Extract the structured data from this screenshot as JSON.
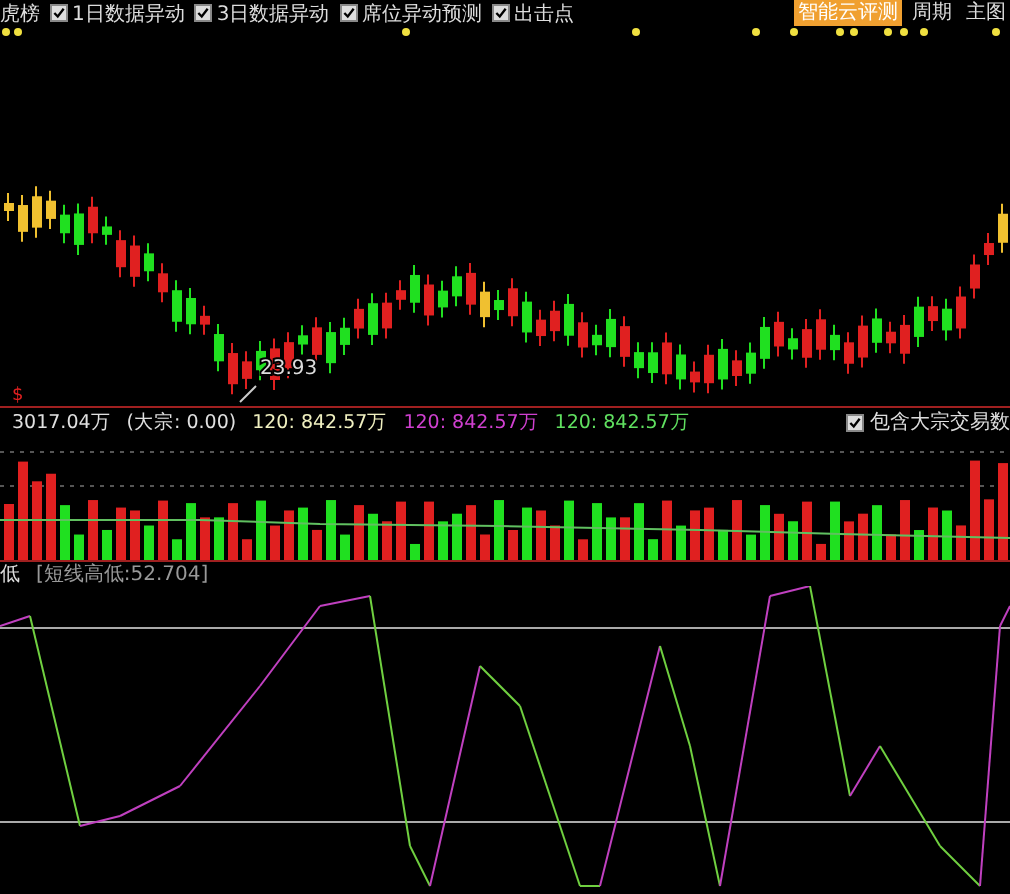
{
  "toolbar": {
    "title": "虎榜",
    "checkboxes": [
      {
        "label": "1日数据异动",
        "checked": true
      },
      {
        "label": "3日数据异动",
        "checked": true
      },
      {
        "label": "席位异动预测",
        "checked": true
      },
      {
        "label": "出击点",
        "checked": true
      }
    ],
    "buttons": [
      {
        "label": "智能云评测",
        "selected": true
      },
      {
        "label": "周期",
        "selected": false
      },
      {
        "label": "主图",
        "selected": false
      }
    ]
  },
  "price_chart": {
    "low_label": "23.93",
    "marker": "$"
  },
  "volume_info": {
    "items": [
      {
        "text": "3017.04万",
        "color": "#e0e0e0"
      },
      {
        "text": "(大宗: 0.00)",
        "color": "#e0e0e0"
      },
      {
        "text": "120: 842.57万",
        "color": "#f0f0c0"
      },
      {
        "text": "120: 842.57万",
        "color": "#d040d0"
      },
      {
        "text": "120: 842.57万",
        "color": "#60e060"
      }
    ],
    "option": {
      "label": "包含大宗交易数",
      "checked": true
    }
  },
  "indicator": {
    "name": "低",
    "value": "[短线高低:52.704]"
  }
}
